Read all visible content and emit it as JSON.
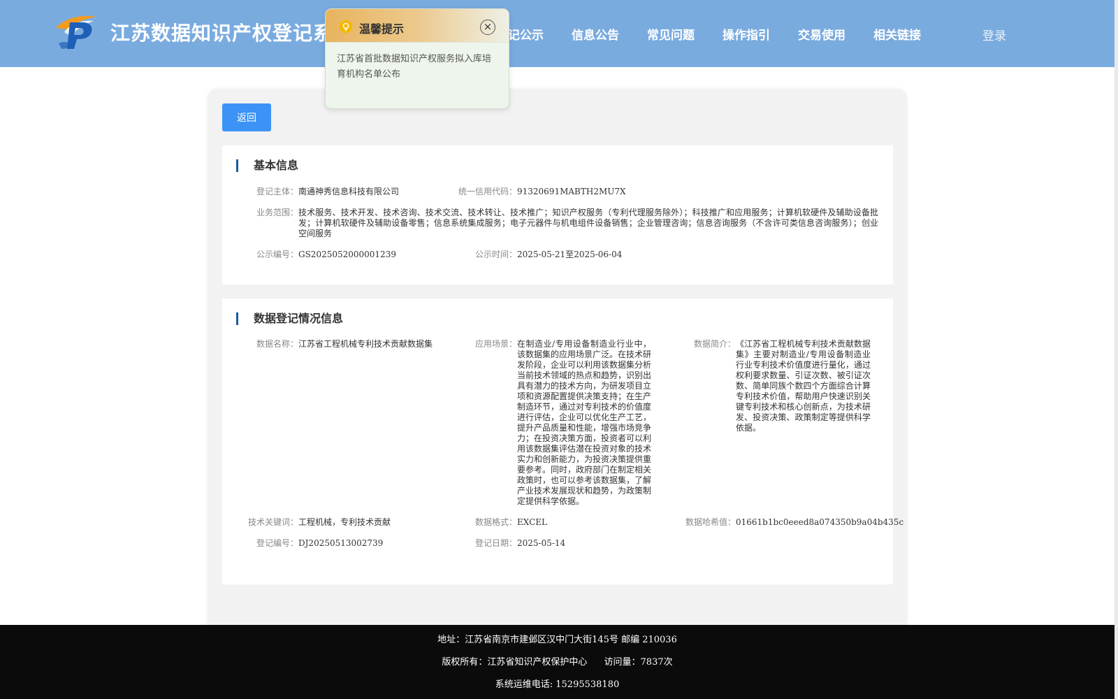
{
  "header": {
    "site_title": "江苏数据知识产权登记系",
    "nav": [
      "记公示",
      "信息公告",
      "常见问题",
      "操作指引",
      "交易使用",
      "相关链接"
    ],
    "login": "登录"
  },
  "popup": {
    "title": "温馨提示",
    "close": "×",
    "message": "江苏省首批数据知识产权服务拟入库培育机构名单公布"
  },
  "back_button": "返回",
  "basic_info": {
    "title": "基本信息",
    "registrant": {
      "label": "登记主体：",
      "value": "南通神秀信息科技有限公司"
    },
    "credit_code": {
      "label": "统一信用代码：",
      "value": "91320691MABTH2MU7X"
    },
    "business_scope": {
      "label": "业务范围：",
      "value": "技术服务、技术开发、技术咨询、技术交流、技术转让、技术推广；知识产权服务（专利代理服务除外）；科技推广和应用服务；计算机软硬件及辅助设备批发；计算机软硬件及辅助设备零售；信息系统集成服务；电子元器件与机电组件设备销售；企业管理咨询；信息咨询服务（不含许可类信息咨询服务）；创业空间服务"
    },
    "publicity_no": {
      "label": "公示编号：",
      "value": "GS2025052000001239"
    },
    "publicity_time": {
      "label": "公示时间：",
      "value": "2025-05-21至2025-06-04"
    }
  },
  "data_info": {
    "title": "数据登记情况信息",
    "data_name": {
      "label": "数据名称：",
      "value": "江苏省工程机械专利技术贡献数据集"
    },
    "scenario": {
      "label": "应用场景：",
      "value": "在制造业/专用设备制造业行业中，该数据集的应用场景广泛。在技术研发阶段，企业可以利用该数据集分析当前技术领域的热点和趋势，识别出具有潜力的技术方向，为研发项目立项和资源配置提供决策支持；在生产制造环节，通过对专利技术的价值度进行评估，企业可以优化生产工艺，提升产品质量和性能，增强市场竞争力；在投资决策方面，投资者可以利用该数据集评估潜在投资对象的技术实力和创新能力，为投资决策提供重要参考。同时，政府部门在制定相关政策时，也可以参考该数据集，了解产业技术发展现状和趋势，为政策制定提供科学依据。"
    },
    "intro": {
      "label": "数据简介：",
      "value": "《江苏省工程机械专利技术贡献数据集》主要对制造业/专用设备制造业行业专利技术价值度进行量化，通过权利要求数量、引证次数、被引证次数、简单同族个数四个方面综合计算专利技术价值，帮助用户快速识别关键专利技术和核心创新点，为技术研发、投资决策、政策制定等提供科学依据。"
    },
    "keywords": {
      "label": "技术关键词：",
      "value": "工程机械，专利技术贡献"
    },
    "format": {
      "label": "数据格式：",
      "value": "EXCEL"
    },
    "hash": {
      "label": "数据哈希值：",
      "value": "01661b1bc0eeed8a074350b9a04b435c"
    },
    "reg_no": {
      "label": "登记编号：",
      "value": "DJ20250513002739"
    },
    "reg_date": {
      "label": "登记日期：",
      "value": "2025-05-14"
    }
  },
  "footer": {
    "address": "地址：江苏省南京市建邺区汉中门大街145号 邮编 210036",
    "copyright": "版权所有：江苏省知识产权保护中心",
    "visits": "访问量：7837次",
    "phone": "系统运维电话: 15295538180"
  },
  "colors": {
    "header_bg": "#7aabdf",
    "primary_button": "#3d93f5",
    "title_bar": "#1a5a9e",
    "footer_bg": "#0b0b0b"
  },
  "icons": {
    "logo": "logo-icon",
    "popup": "lightbulb-icon",
    "close": "close-icon"
  }
}
